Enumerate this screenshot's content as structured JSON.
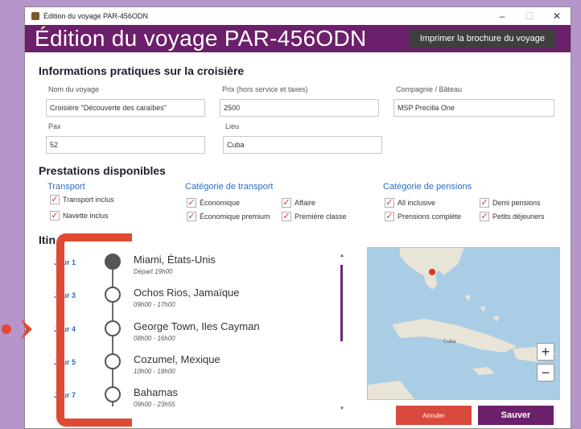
{
  "window": {
    "title": "Édition du voyage PAR-456ODN",
    "controls": [
      "–",
      "☐",
      "✕"
    ]
  },
  "header": {
    "title": "Édition du voyage PAR-456ODN",
    "print_label": "Imprimer la brochure du voyage"
  },
  "info": {
    "section_title": "Informations pratiques sur la croisière",
    "fields": {
      "name": {
        "label": "Nom du voyage",
        "value": "Croisière \"Découverte des caraïbes\""
      },
      "price": {
        "label": "Prix (hors service et taxes)",
        "value": "2500"
      },
      "company": {
        "label": "Compagnie / Bâteau",
        "value": "MSP Precilia One"
      },
      "pax": {
        "label": "Pax",
        "value": "52"
      },
      "place": {
        "label": "Lieu",
        "value": "Cuba"
      }
    }
  },
  "services": {
    "section_title": "Prestations disponibles",
    "transport": {
      "title": "Transport",
      "items": [
        "Transport inclus",
        "Navette inclus"
      ]
    },
    "transport_category": {
      "title": "Catégorie de transport",
      "items": [
        "Économique",
        "Affaire",
        "Économique premium",
        "Première classe"
      ]
    },
    "board_category": {
      "title": "Catégorie de pensions",
      "items": [
        "All inclusive",
        "Demi pensions",
        "Prensions complète",
        "Petits déjeuners"
      ]
    }
  },
  "itinerary": {
    "section_title": "Itin",
    "stops": [
      {
        "day": "Jour 1",
        "place": "Miami, États-Unis",
        "time": "Départ 19h00"
      },
      {
        "day": "Jour 3",
        "place": "Ochos Rios, Jamaïque",
        "time": "09h00 - 17h00"
      },
      {
        "day": "Jour 4",
        "place": "George Town, Iles Cayman",
        "time": "08h00 - 16h00"
      },
      {
        "day": "Jour 5",
        "place": "Cozumel, Mexique",
        "time": "10h00 - 18h00"
      },
      {
        "day": "Jour 7",
        "place": "Bahamas",
        "time": "09h00 - 23h55"
      }
    ]
  },
  "map": {
    "labels": [
      "Cuba"
    ],
    "zoom_in": "+",
    "zoom_out": "−"
  },
  "actions": {
    "cancel_label": "Annuler",
    "save_label": "Sauver"
  },
  "colors": {
    "brand": "#6c1f6a",
    "accent_blue": "#2a6fc0",
    "cancel": "#d84a3e",
    "annotation": "#e04a34"
  }
}
